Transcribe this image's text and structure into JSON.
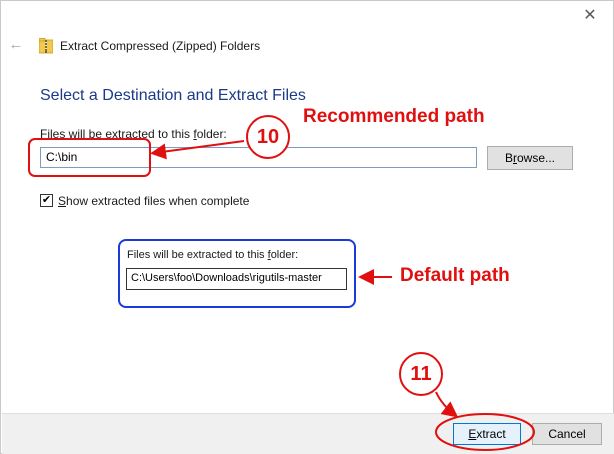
{
  "window": {
    "title": "Extract Compressed (Zipped) Folders",
    "back_icon": "back-arrow-icon",
    "close_label": "✕",
    "folder_icon": "zip-folder-icon"
  },
  "main": {
    "heading": "Select a Destination and Extract Files",
    "destination_label_prefix": "Files will be extracted to this ",
    "destination_label_access": "f",
    "destination_label_suffix": "older:",
    "destination_value": "C:\\bin",
    "browse_label_prefix": "B",
    "browse_label_access": "r",
    "browse_label_suffix": "owse...",
    "show_files_access": "S",
    "show_files_label": "how extracted files when complete",
    "show_files_checked": true,
    "checkmark": "✔"
  },
  "callout": {
    "label_prefix": "Files will be extracted to this ",
    "label_access": "f",
    "label_suffix": "older:",
    "value": "C:\\Users\\foo\\Downloads\\rigutils-master"
  },
  "footer": {
    "extract_access": "E",
    "extract_label": "xtract",
    "cancel_label": "Cancel"
  },
  "annotations": {
    "recommended": "Recommended path",
    "default": "Default path",
    "step_10": "10",
    "step_11": "11",
    "color_red": "#e01010",
    "color_blue": "#1c3ad6"
  }
}
